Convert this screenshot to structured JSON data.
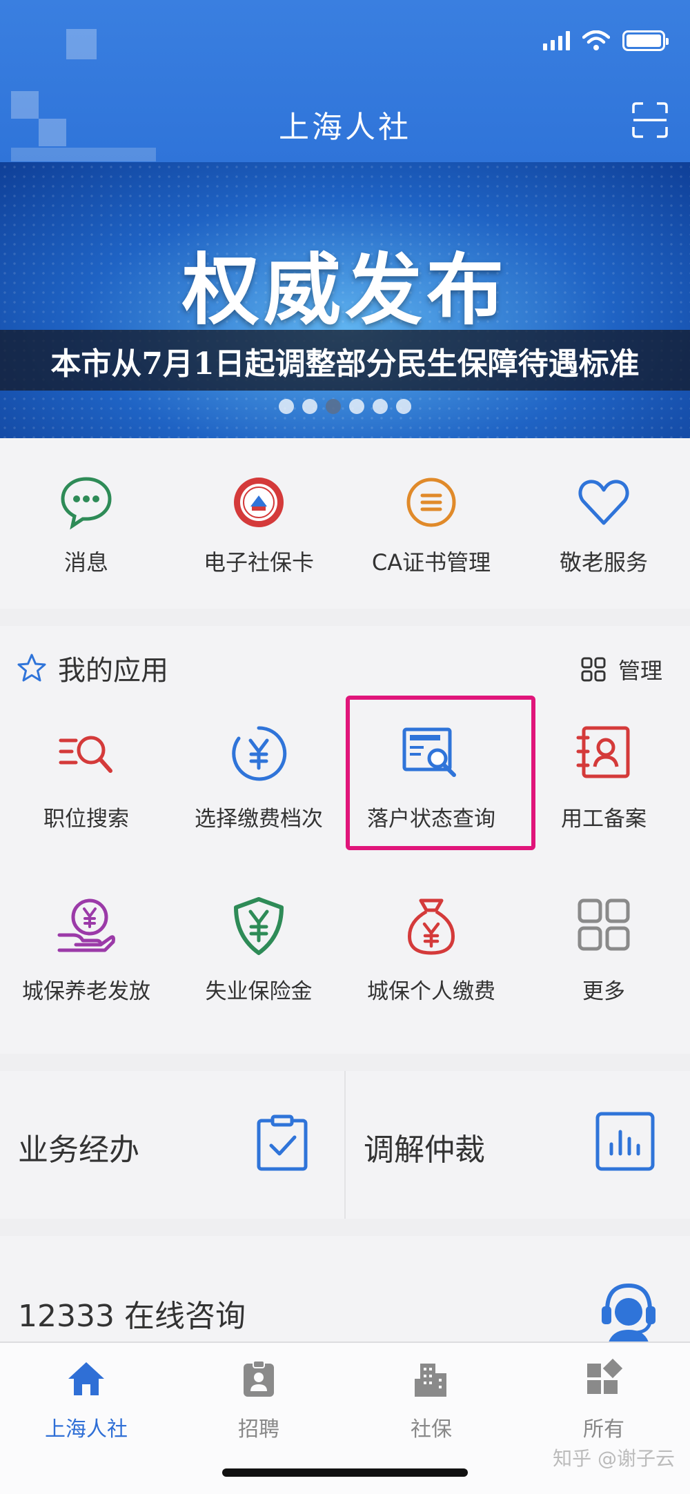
{
  "header": {
    "title": "上海人社"
  },
  "banner": {
    "heading": "权威发布",
    "caption": "本市从7月1日起调整部分民生保障待遇标准",
    "page_count": 6,
    "active_index": 2
  },
  "quick_services": [
    {
      "label": "消息",
      "icon": "chat-icon"
    },
    {
      "label": "电子社保卡",
      "icon": "social-security-card-icon"
    },
    {
      "label": "CA证书管理",
      "icon": "certificate-list-icon"
    },
    {
      "label": "敬老服务",
      "icon": "heart-icon"
    }
  ],
  "my_apps": {
    "title": "我的应用",
    "manage_label": "管理",
    "items": [
      {
        "label": "职位搜索",
        "icon": "job-search-icon"
      },
      {
        "label": "选择缴费档次",
        "icon": "yuan-circle-icon"
      },
      {
        "label": "落户状态查询",
        "icon": "document-search-icon",
        "highlighted": true
      },
      {
        "label": "用工备案",
        "icon": "employee-record-icon"
      },
      {
        "label": "城保养老发放",
        "icon": "pension-hand-icon"
      },
      {
        "label": "失业保险金",
        "icon": "shield-yuan-icon"
      },
      {
        "label": "城保个人缴费",
        "icon": "money-bag-icon"
      },
      {
        "label": "更多",
        "icon": "grid-more-icon"
      }
    ]
  },
  "tiles": [
    {
      "label": "业务经办",
      "icon": "clipboard-check-icon"
    },
    {
      "label": "调解仲裁",
      "icon": "bar-chart-icon"
    }
  ],
  "consult": {
    "label": "12333 在线咨询",
    "icon": "headset-agent-icon"
  },
  "tabbar": [
    {
      "label": "上海人社",
      "icon": "home-icon",
      "active": true
    },
    {
      "label": "招聘",
      "icon": "badge-icon",
      "active": false
    },
    {
      "label": "社保",
      "icon": "building-icon",
      "active": false
    },
    {
      "label": "所有",
      "icon": "apps-icon",
      "active": false
    }
  ],
  "watermark": "知乎 @谢子云",
  "colors": {
    "primary": "#2f74d9",
    "highlight": "#e0157a",
    "green": "#2e8b57",
    "red": "#d43a3a",
    "orange": "#e08a2a",
    "purple": "#9b3aa8"
  }
}
